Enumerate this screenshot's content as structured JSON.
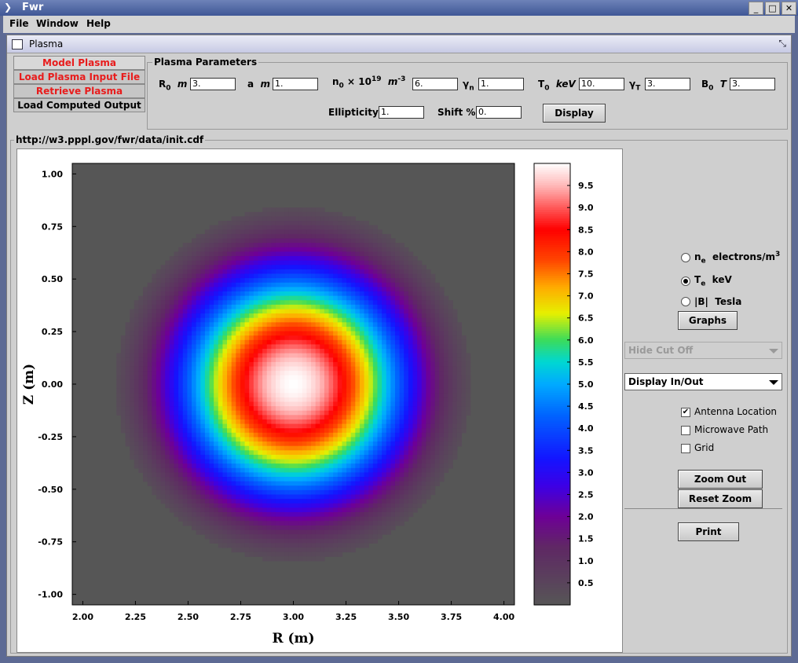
{
  "window": {
    "title": "Fwr",
    "minimize": "_",
    "maximize": "□",
    "close": "✕"
  },
  "menu": [
    "File",
    "Window",
    "Help"
  ],
  "internal_frame": {
    "title": "Plasma"
  },
  "left_tabs": [
    "Model Plasma",
    "Load Plasma Input File",
    "Retrieve Plasma",
    "Load Computed Output"
  ],
  "params": {
    "group_title": "Plasma Parameters",
    "R0": {
      "label": "R",
      "sub": "0",
      "unit": "m",
      "value": "3."
    },
    "a": {
      "label": "a",
      "unit": "m",
      "value": "1."
    },
    "n0": {
      "label": "n",
      "sub": "0",
      "mult": "× 10",
      "exp": "19",
      "unit": "m",
      "unit_exp": "-3",
      "value": "6."
    },
    "gn": {
      "label": "γ",
      "sub": "n",
      "value": "1."
    },
    "T0": {
      "label": "T",
      "sub": "0",
      "unit": "keV",
      "value": "10."
    },
    "gT": {
      "label": "γ",
      "sub": "T",
      "value": "3."
    },
    "B0": {
      "label": "B",
      "sub": "0",
      "unit": "T",
      "value": "3."
    },
    "ellipticity": {
      "label": "Ellipticity",
      "value": "1."
    },
    "shift": {
      "label": "Shift %",
      "value": "0."
    },
    "display_button": "Display"
  },
  "url_label": "http://w3.pppl.gov/fwr/data/init.cdf",
  "chart_data": {
    "type": "heatmap",
    "xlabel": "R (m)",
    "ylabel": "Z (m)",
    "xlim": [
      1.95,
      4.05
    ],
    "ylim": [
      -1.05,
      1.05
    ],
    "xticks": [
      "2.00",
      "2.25",
      "2.50",
      "2.75",
      "3.00",
      "3.25",
      "3.50",
      "3.75",
      "4.00"
    ],
    "yticks": [
      "1.00",
      "0.75",
      "0.50",
      "0.25",
      "0.00",
      "-0.25",
      "-0.50",
      "-0.75",
      "-1.00"
    ],
    "center": [
      3.0,
      0.0
    ],
    "minor_radius": 1.0,
    "peak": 10.0,
    "profile_exponent": 3,
    "background_color": "#565656",
    "colorbar_ticks": [
      "9.5",
      "9.0",
      "8.5",
      "8.0",
      "7.5",
      "7.0",
      "6.5",
      "6.0",
      "5.5",
      "5.0",
      "4.5",
      "4.0",
      "3.5",
      "3.0",
      "2.5",
      "2.0",
      "1.5",
      "1.0",
      "0.5"
    ],
    "colorbar_range": [
      0,
      10
    ]
  },
  "side": {
    "radio_ne": {
      "label": "n",
      "sub": "e",
      "unit": "electrons/m",
      "exp": "3"
    },
    "radio_te": {
      "label": "T",
      "sub": "e",
      "unit": "keV"
    },
    "radio_b": {
      "label": "|B|",
      "unit": "Tesla"
    },
    "graphs": "Graphs",
    "hide_cutoff": "Hide Cut Off",
    "display_inout": "Display In/Out",
    "cb_antenna": "Antenna Location",
    "cb_microwave": "Microwave Path",
    "cb_grid": "Grid",
    "zoom_out": "Zoom Out",
    "reset_zoom": "Reset Zoom",
    "print": "Print"
  }
}
